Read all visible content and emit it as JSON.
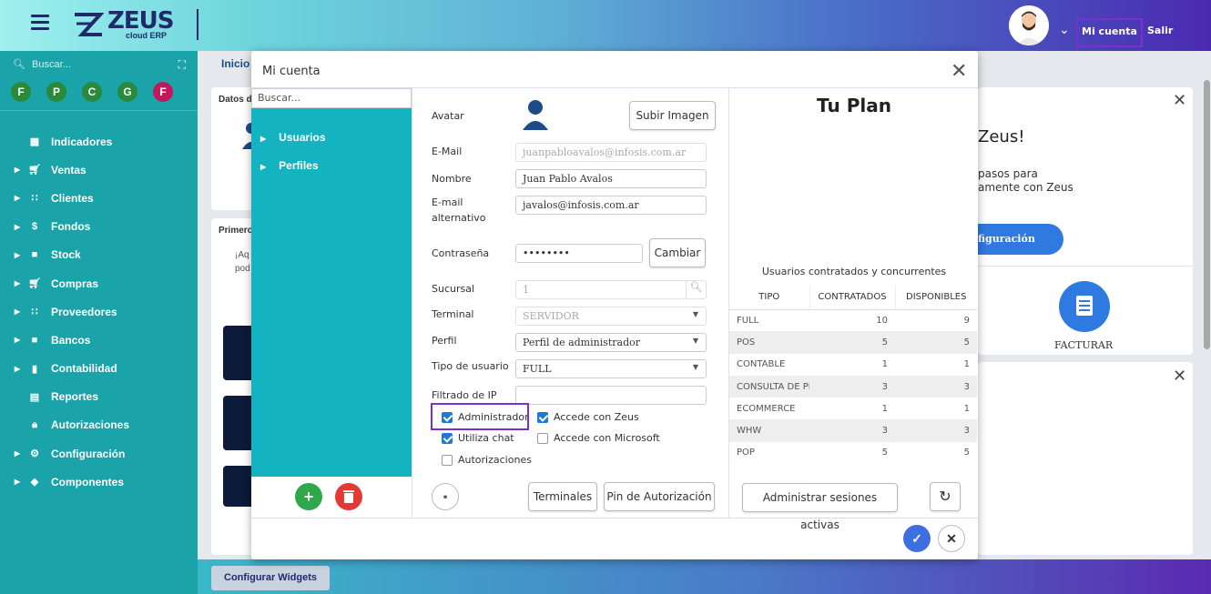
{
  "header": {
    "logo_text": "ZEUS",
    "logo_sub": "cloud ERP",
    "account_label": "Mi cuenta",
    "logout_label": "Salir"
  },
  "sidebar": {
    "search_placeholder": "Buscar...",
    "favorites": [
      "F",
      "P",
      "C",
      "G",
      "F"
    ],
    "items": [
      {
        "label": "Indicadores",
        "icon": "dashboard-icon"
      },
      {
        "label": "Ventas",
        "icon": "cart-icon"
      },
      {
        "label": "Clientes",
        "icon": "users-icon"
      },
      {
        "label": "Fondos",
        "icon": "dollar-icon"
      },
      {
        "label": "Stock",
        "icon": "box-icon"
      },
      {
        "label": "Compras",
        "icon": "cart-plus-icon"
      },
      {
        "label": "Proveedores",
        "icon": "users-icon"
      },
      {
        "label": "Bancos",
        "icon": "briefcase-icon"
      },
      {
        "label": "Contabilidad",
        "icon": "book-icon"
      },
      {
        "label": "Reportes",
        "icon": "report-icon"
      },
      {
        "label": "Autorizaciones",
        "icon": "lock-icon"
      },
      {
        "label": "Configuración",
        "icon": "gear-icon"
      },
      {
        "label": "Componentes",
        "icon": "tag-icon"
      }
    ]
  },
  "background": {
    "breadcrumb": "Inicio",
    "datos_label": "Datos d",
    "primero_label": "Primero",
    "aq_text": "¡Aq",
    "pod_text": "pod",
    "welcome_title": "Zeus!",
    "welcome_line1": "pasos para",
    "welcome_line2": "amente con Zeus",
    "config_button": "figuración",
    "facturar_label": "FACTURAR",
    "configure_widgets": "Configurar Widgets"
  },
  "modal": {
    "title": "Mi cuenta",
    "tree_search_placeholder": "Buscar...",
    "tree": [
      "Usuarios",
      "Perfiles"
    ],
    "form": {
      "avatar_label": "Avatar",
      "upload_button": "Subir Imagen",
      "email_label": "E-Mail",
      "email_value": "juanpabloavalos@infosis.com.ar",
      "name_label": "Nombre",
      "name_value": "Juan Pablo Avalos",
      "alt_email_label_1": "E-mail",
      "alt_email_label_2": "alternativo",
      "alt_email_value": "javalos@infosis.com.ar",
      "password_label": "Contraseña",
      "password_value": "••••••••",
      "change_button": "Cambiar",
      "branch_label": "Sucursal",
      "branch_value": "1",
      "terminal_label": "Terminal",
      "terminal_value": "SERVIDOR",
      "profile_label": "Perfil",
      "profile_value": "Perfil de administrador",
      "user_type_label": "Tipo de usuario",
      "user_type_value": "FULL",
      "ip_filter_label": "Filtrado de IP",
      "ip_filter_value": "",
      "checks": {
        "admin": {
          "label": "Administrador",
          "checked": true
        },
        "zeus": {
          "label": "Accede con Zeus",
          "checked": true
        },
        "chat": {
          "label": "Utiliza chat",
          "checked": true
        },
        "microsoft": {
          "label": "Accede con Microsoft",
          "checked": false
        },
        "authorizations": {
          "label": "Autorizaciones",
          "checked": false
        }
      },
      "terminals_button": "Terminales",
      "pin_button": "Pin de Autorización"
    },
    "plan": {
      "title": "Tu Plan",
      "caption": "Usuarios contratados y concurrentes",
      "columns": [
        "TIPO",
        "CONTRATADOS",
        "DISPONIBLES"
      ],
      "rows": [
        [
          "FULL",
          "10",
          "9"
        ],
        [
          "POS",
          "5",
          "5"
        ],
        [
          "CONTABLE",
          "1",
          "1"
        ],
        [
          "CONSULTA DE PI",
          "3",
          "3"
        ],
        [
          "ECOMMERCE",
          "1",
          "1"
        ],
        [
          "WHW",
          "3",
          "3"
        ],
        [
          "POP",
          "5",
          "5"
        ]
      ],
      "sessions_button": "Administrar sesiones activas"
    }
  }
}
